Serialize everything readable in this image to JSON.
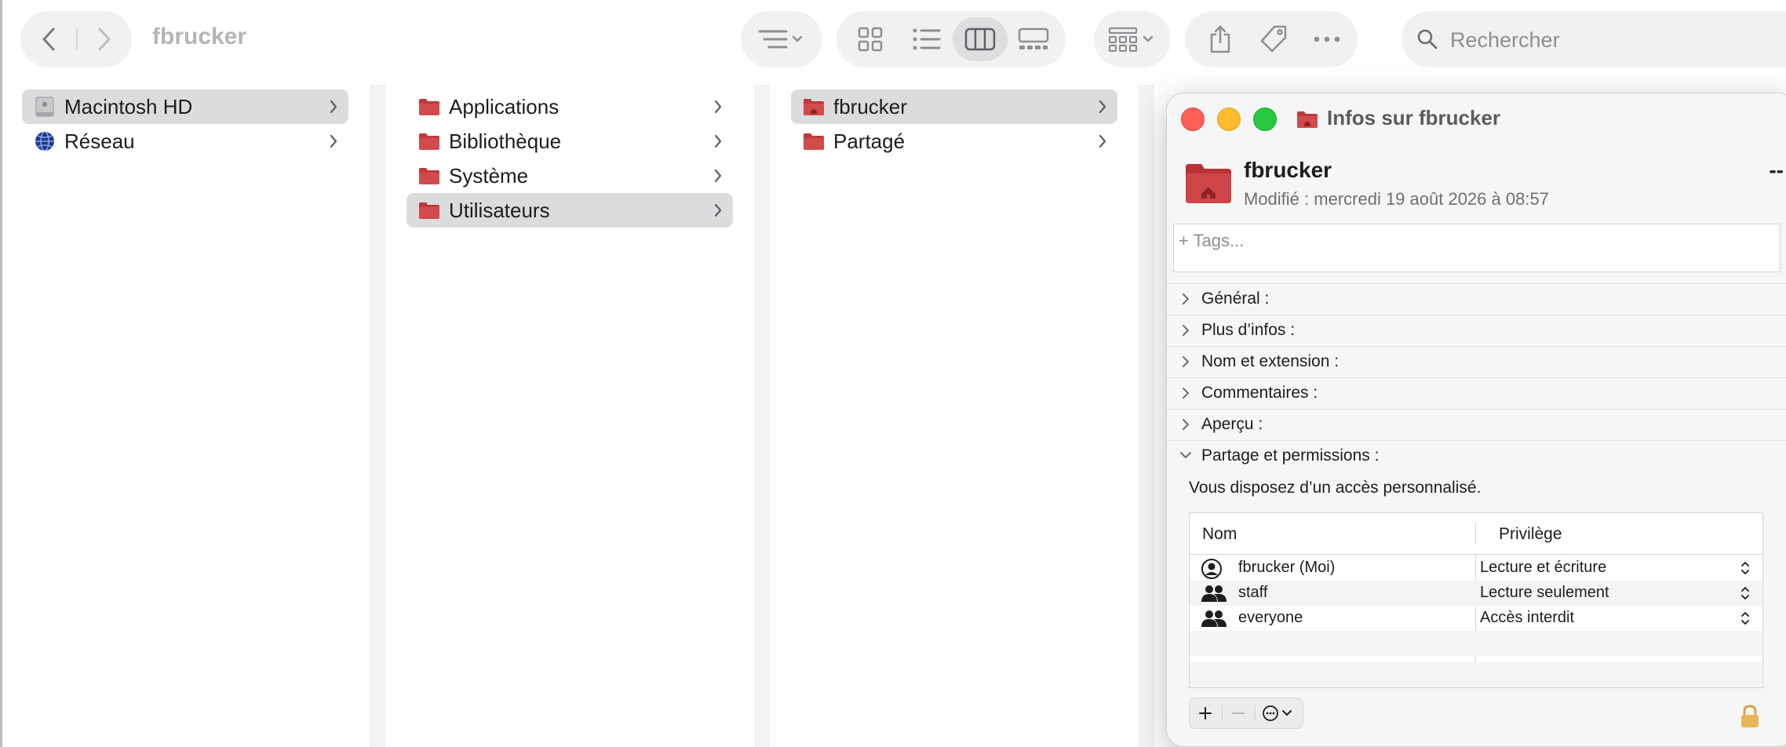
{
  "toolbar": {
    "title": "fbrucker",
    "search_placeholder": "Rechercher",
    "icons": [
      "back-chevron-icon",
      "forward-chevron-icon",
      "sort-list-icon",
      "view-icons-icon",
      "view-list-icon",
      "view-columns-icon",
      "view-gallery-icon",
      "group-icon",
      "share-icon",
      "tag-icon",
      "more-icon",
      "search-icon"
    ],
    "active_view": "columns"
  },
  "columns": [
    {
      "items": [
        {
          "label": "Macintosh HD",
          "icon": "hard-drive-icon",
          "selected": true
        },
        {
          "label": "Réseau",
          "icon": "network-globe-icon",
          "selected": false
        }
      ]
    },
    {
      "items": [
        {
          "label": "Applications",
          "icon": "folder-icon",
          "selected": false
        },
        {
          "label": "Bibliothèque",
          "icon": "folder-icon",
          "selected": false
        },
        {
          "label": "Système",
          "icon": "folder-icon",
          "selected": false
        },
        {
          "label": "Utilisateurs",
          "icon": "folder-icon",
          "selected": true
        }
      ]
    },
    {
      "items": [
        {
          "label": "fbrucker",
          "icon": "home-folder-icon",
          "selected": true
        },
        {
          "label": "Partagé",
          "icon": "folder-icon",
          "selected": false
        }
      ]
    }
  ],
  "info_window": {
    "title": "Infos sur fbrucker",
    "name": "fbrucker",
    "size": "--",
    "modified": "Modifié : mercredi 19 août 2026 à 08:57",
    "tags_placeholder": "+ Tags...",
    "sections": [
      {
        "label": "Général :",
        "expanded": false
      },
      {
        "label": "Plus d’infos :",
        "expanded": false
      },
      {
        "label": "Nom et extension :",
        "expanded": false
      },
      {
        "label": "Commentaires :",
        "expanded": false
      },
      {
        "label": "Aperçu :",
        "expanded": false
      },
      {
        "label": "Partage et permissions :",
        "expanded": true
      }
    ],
    "permissions_message": "Vous disposez d’un accès personnalisé.",
    "table": {
      "headers": {
        "name": "Nom",
        "privilege": "Privilège"
      },
      "rows": [
        {
          "name": "fbrucker (Moi)",
          "icon": "user-icon",
          "privilege": "Lecture et écriture"
        },
        {
          "name": "staff",
          "icon": "group-users-icon",
          "privilege": "Lecture seulement"
        },
        {
          "name": "everyone",
          "icon": "group-users-icon",
          "privilege": "Accès interdit"
        }
      ]
    },
    "colors": {
      "close": "#fe5f57",
      "minimize": "#febc2e",
      "zoom": "#28c840",
      "folder": "#c0393b"
    }
  }
}
